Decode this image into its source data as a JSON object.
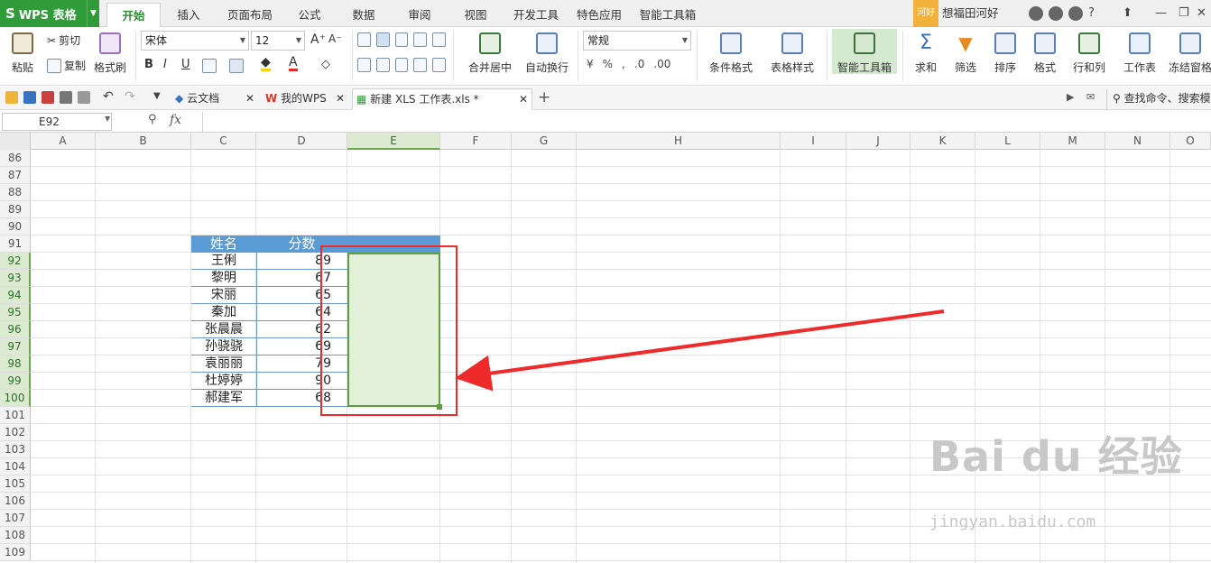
{
  "app": {
    "logo": "WPS 表格"
  },
  "menu": {
    "tabs": [
      "开始",
      "插入",
      "页面布局",
      "公式",
      "数据",
      "审阅",
      "视图",
      "开发工具",
      "特色应用",
      "智能工具箱"
    ]
  },
  "user": {
    "badge": "河好",
    "name": "想福田河好"
  },
  "ribbon": {
    "paste": "粘贴",
    "cut": "剪切",
    "copy": "复制",
    "format_painter": "格式刷",
    "font_name": "宋体",
    "font_size": "12",
    "merge_center": "合并居中",
    "wrap_text": "自动换行",
    "number_format": "常规",
    "cond_format": "条件格式",
    "table_style": "表格样式",
    "smart_toolbox": "智能工具箱",
    "sum": "求和",
    "filter": "筛选",
    "sort": "排序",
    "format": "格式",
    "rows_cols": "行和列",
    "worksheet": "工作表",
    "freeze": "冻结窗格"
  },
  "doctabs": {
    "cloud": "云文档",
    "mywps": "我的WPS",
    "file": "新建 XLS 工作表.xls *",
    "search": "查找命令、搜索模"
  },
  "formula": {
    "cell_ref": "E92",
    "fx": "fx",
    "value": ""
  },
  "grid": {
    "columns": [
      "A",
      "B",
      "C",
      "D",
      "E",
      "F",
      "G",
      "H",
      "I",
      "J",
      "K",
      "L",
      "M",
      "N",
      "O"
    ],
    "rows": [
      "86",
      "87",
      "88",
      "89",
      "90",
      "91",
      "92",
      "93",
      "94",
      "95",
      "96",
      "97",
      "98",
      "99",
      "100",
      "101",
      "102",
      "103",
      "104",
      "105",
      "106",
      "107",
      "108",
      "109"
    ],
    "table_headers": [
      "姓名",
      "分数"
    ],
    "table_rows": [
      {
        "name": "王俐",
        "score": "89"
      },
      {
        "name": "黎明",
        "score": "67"
      },
      {
        "name": "宋丽",
        "score": "65"
      },
      {
        "name": "秦加",
        "score": "64"
      },
      {
        "name": "张晨晨",
        "score": "62"
      },
      {
        "name": "孙骁骁",
        "score": "69"
      },
      {
        "name": "袁丽丽",
        "score": "79"
      },
      {
        "name": "杜婷婷",
        "score": "90"
      },
      {
        "name": "郝建军",
        "score": "68"
      }
    ]
  },
  "watermark": {
    "brand": "Bai du 经验",
    "url": "jingyan.baidu.com"
  },
  "colors": {
    "accent_green": "#2f9b39",
    "header_blue": "#5b9bd5",
    "selection_fill": "#e2f0d9",
    "annotation_red": "#ee2a2a"
  }
}
